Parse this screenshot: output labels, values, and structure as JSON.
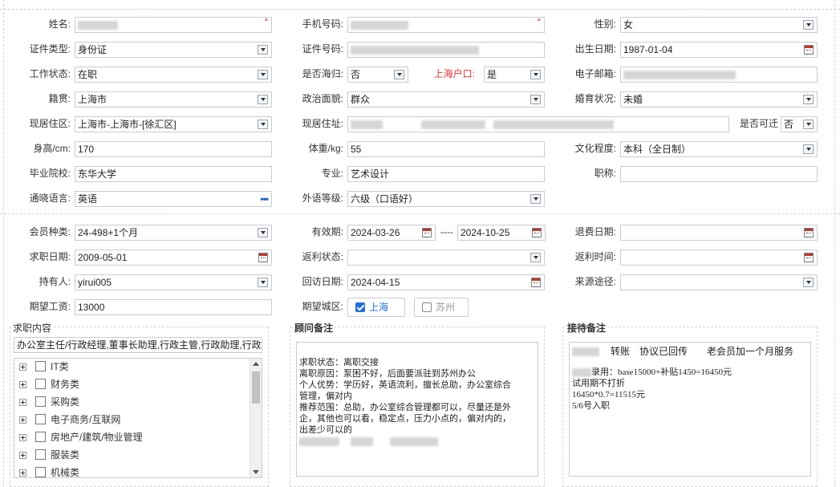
{
  "personal": {
    "name_label": "姓名:",
    "phone_label": "手机号码:",
    "gender_label": "性别:",
    "gender_value": "女",
    "id_type_label": "证件类型:",
    "id_type_value": "身份证",
    "id_no_label": "证件号码:",
    "birth_label": "出生日期:",
    "birth_value": "1987-01-04",
    "work_status_label": "工作状态:",
    "work_status_value": "在职",
    "returnee_label": "是否海归:",
    "returnee_value": "否",
    "shanghai_hukou_label": "上海户口:",
    "shanghai_hukou_value": "是",
    "email_label": "电子邮箱:",
    "native_label": "籍贯:",
    "native_value": "上海市",
    "political_label": "政治面貌:",
    "political_value": "群众",
    "marital_label": "婚育状况:",
    "marital_value": "未婚",
    "region_label": "现居住区:",
    "region_value": "上海市-上海市-[徐汇区]",
    "address_label": "现居住址:",
    "relocate_label": "是否可迁",
    "relocate_value": "否",
    "height_label": "身高/cm:",
    "height_value": "170",
    "weight_label": "体重/kg:",
    "weight_value": "55",
    "education_label": "文化程度:",
    "education_value": "本科（全日制）",
    "school_label": "毕业院校:",
    "school_value": "东华大学",
    "major_label": "专业:",
    "major_value": "艺术设计",
    "title_label": "职称:",
    "language_label": "通晓语言:",
    "language_value": "英语",
    "lang_level_label": "外语等级:",
    "lang_level_value": "六级（口语好）"
  },
  "membership": {
    "type_label": "会员种类:",
    "type_value": "24-498+1个月",
    "valid_label": "有效期:",
    "valid_from": "2024-03-26",
    "valid_sep": "----",
    "valid_to": "2024-10-25",
    "refund_date_label": "退费日期:",
    "job_date_label": "求职日期:",
    "job_date_value": "2009-05-01",
    "rebate_status_label": "返利状态:",
    "rebate_time_label": "返利时间:",
    "holder_label": "持有人:",
    "holder_value": "yirui005",
    "visit_date_label": "回访日期:",
    "visit_date_value": "2024-04-15",
    "source_label": "来源途径:",
    "salary_label": "期望工资:",
    "salary_value": "13000",
    "city_label": "期望城区:",
    "city_options": [
      {
        "label": "上海",
        "checked": true
      },
      {
        "label": "苏州",
        "checked": false
      }
    ]
  },
  "job_content": {
    "title": "求职内容",
    "summary": "办公室主任/行政经理,董事长助理,行政主管,行政助理,行政",
    "categories": [
      "IT类",
      "财务类",
      "采购类",
      "电子商务/互联网",
      "房地产/建筑/物业管理",
      "服装类",
      "机械类"
    ]
  },
  "advisor_notes": {
    "title": "顾问备注",
    "lines": [
      "",
      "求职状态：离职交接",
      "离职原因：泵困不好，后面要派驻到苏州办公",
      "个人优势：学历好，英语流利，擅长总助，办公室综合",
      "管理，偏对内",
      "推荐范围：总助，办公室综合管理都可以，尽量还是外",
      "企，其他也可以看，稳定点，压力小点的，偏对内的，",
      "出差少可以的"
    ]
  },
  "reception_notes": {
    "title": "接待备注",
    "line1": "转账　协议已回传　　老会员加一个月服务",
    "line2": "录用：base15000+补贴1450=16450元",
    "line3": "试用期不打折",
    "line4": "16450*0.7=11515元",
    "line5": "5/6号入职"
  }
}
